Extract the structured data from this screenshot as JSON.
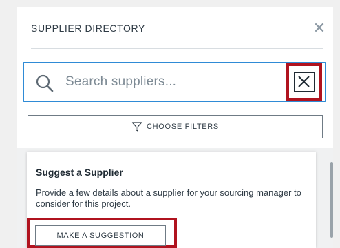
{
  "panel": {
    "title": "SUPPLIER DIRECTORY",
    "close_icon": "close-icon"
  },
  "search": {
    "placeholder": "Search suppliers...",
    "value": "",
    "search_icon": "search-icon",
    "clear_icon": "clear-icon"
  },
  "filters": {
    "label": "CHOOSE FILTERS",
    "icon": "filter-icon"
  },
  "suggest_card": {
    "title": "Suggest a Supplier",
    "description": "Provide a few details about a supplier for your sourcing manager to consider for this project.",
    "button_label": "MAKE A SUGGESTION"
  },
  "colors": {
    "accent_blue": "#2f8bd6",
    "highlight_red": "#b0131f",
    "text_dark": "#2f3b45"
  }
}
